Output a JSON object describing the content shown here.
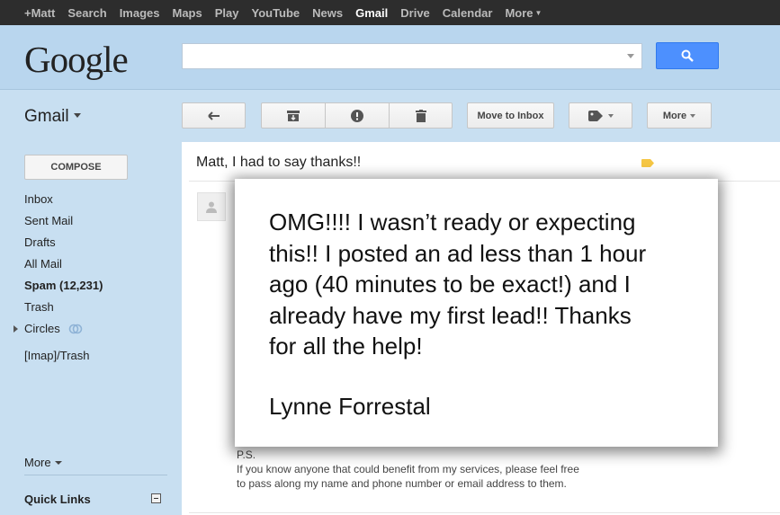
{
  "topbar": {
    "items": [
      {
        "label": "+Matt",
        "active": false
      },
      {
        "label": "Search",
        "active": false
      },
      {
        "label": "Images",
        "active": false
      },
      {
        "label": "Maps",
        "active": false
      },
      {
        "label": "Play",
        "active": false
      },
      {
        "label": "YouTube",
        "active": false
      },
      {
        "label": "News",
        "active": false
      },
      {
        "label": "Gmail",
        "active": true
      },
      {
        "label": "Drive",
        "active": false
      },
      {
        "label": "Calendar",
        "active": false
      },
      {
        "label": "More",
        "active": false
      }
    ]
  },
  "header": {
    "logo": "Google",
    "search": {
      "value": "",
      "placeholder": ""
    },
    "search_button_icon": "search-icon"
  },
  "sidebar": {
    "app_label": "Gmail",
    "compose_label": "COMPOSE",
    "items": [
      {
        "label": "Inbox"
      },
      {
        "label": "Sent Mail"
      },
      {
        "label": "Drafts"
      },
      {
        "label": "All Mail"
      },
      {
        "label": "Spam (12,231)"
      },
      {
        "label": "Trash"
      },
      {
        "label": "Circles"
      },
      {
        "label": "[Imap]/Trash"
      }
    ],
    "more_label": "More",
    "quick_links_label": "Quick Links"
  },
  "toolbar": {
    "back_icon": "back-arrow-icon",
    "archive_icon": "archive-icon",
    "spam_icon": "report-spam-icon",
    "delete_icon": "trash-icon",
    "move_to_inbox_label": "Move to Inbox",
    "labels_icon": "label-icon",
    "more_label": "More"
  },
  "message": {
    "subject": "Matt, I had to say thanks!!",
    "label_color": "#f5c644",
    "ps_lines": [
      "P.S.",
      "If you know anyone that could benefit from my services, please feel free",
      "to pass along my name and phone number or email address to them."
    ]
  },
  "testimonial": {
    "lines": [
      "OMG!!!! I wasn’t ready or expecting",
      "this!! I posted an ad less than 1 hour",
      "ago (40 minutes to be exact!) and I",
      "already have my first lead!! Thanks",
      "for all the help!"
    ],
    "signature": "Lynne Forrestal"
  },
  "colors": {
    "top_bar": "#2d2d2d",
    "header_bg": "#b9d6ee",
    "sidebar_bg": "#c8dff1",
    "search_button": "#4d90fe"
  }
}
